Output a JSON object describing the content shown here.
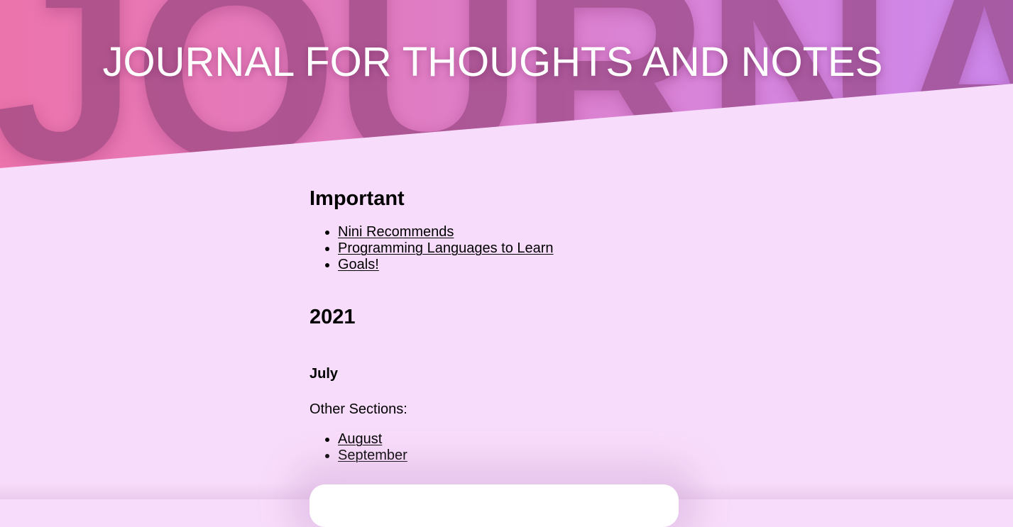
{
  "header": {
    "background_word": "JOURNAL",
    "title": "JOURNAL FOR THOUGHTS AND NOTES",
    "gradient_colors": [
      "#ec74ac",
      "#cc88ec"
    ]
  },
  "important": {
    "heading": "Important",
    "links": [
      {
        "label": "Nini Recommends"
      },
      {
        "label": "Programming Languages to Learn"
      },
      {
        "label": "Goals!"
      }
    ]
  },
  "year": {
    "heading": "2021"
  },
  "month": {
    "heading": "July",
    "other_sections_label": "Other Sections:",
    "links": [
      {
        "label": "August"
      },
      {
        "label": "September"
      }
    ]
  },
  "colors": {
    "page_background": "#f8dcfb",
    "text": "#000000",
    "card": "#ffffff"
  }
}
